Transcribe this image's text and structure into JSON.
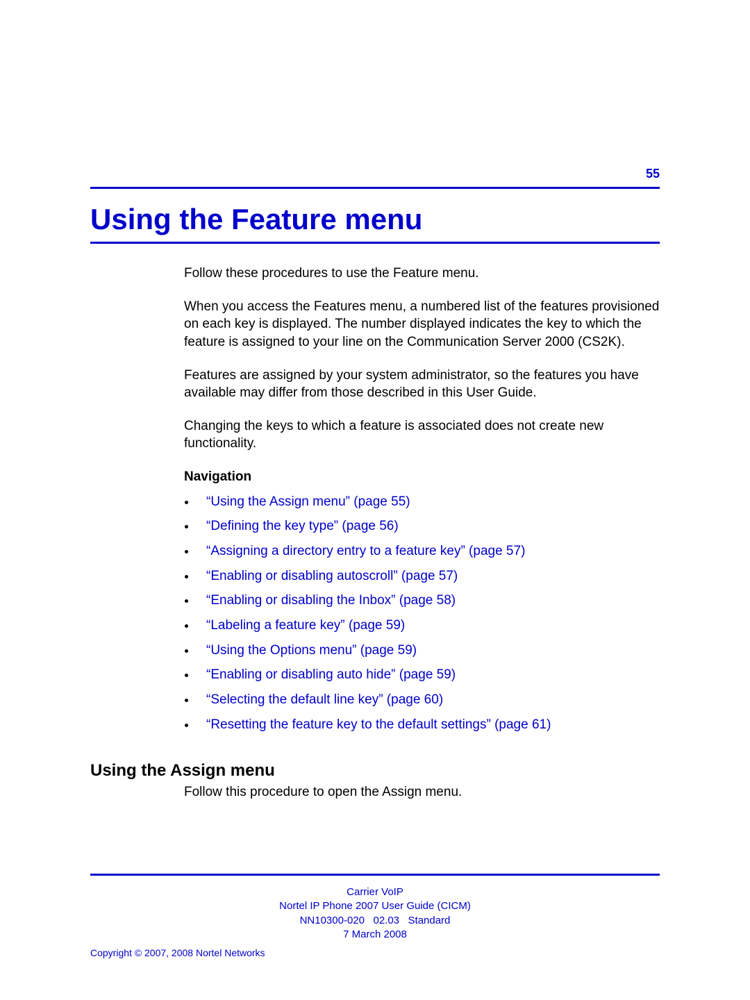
{
  "page_number": "55",
  "chapter_title": "Using the Feature menu",
  "paragraphs": {
    "p1": "Follow these procedures to use the Feature menu.",
    "p2": "When you access the Features menu, a numbered list of the features provisioned on each key is displayed. The number displayed indicates the key to which the feature is assigned to your line on the Communication Server 2000 (CS2K).",
    "p3": "Features are assigned by your system administrator, so the features you have available may differ from those described in this User Guide.",
    "p4": "Changing the keys to which a feature is associated does not create new functionality."
  },
  "nav_heading": "Navigation",
  "nav_items": [
    "“Using the Assign menu” (page 55)",
    "“Defining the key type” (page 56)",
    "“Assigning a directory entry to a feature key” (page 57)",
    "“Enabling or disabling autoscroll” (page 57)",
    "“Enabling or disabling the Inbox” (page 58)",
    "“Labeling a feature key” (page 59)",
    "“Using the Options menu” (page 59)",
    "“Enabling or disabling auto hide” (page 59)",
    "“Selecting the default line key” (page 60)",
    "“Resetting the feature key to the default settings” (page 61)"
  ],
  "section_heading": "Using the Assign menu",
  "section_text": "Follow this procedure to open the Assign menu.",
  "footer": {
    "line1": "Carrier VoIP",
    "line2": "Nortel IP Phone 2007 User Guide (CICM)",
    "line3": "NN10300-020   02.03   Standard",
    "line4": "7 March 2008",
    "copyright": "Copyright © 2007, 2008 Nortel Networks"
  }
}
